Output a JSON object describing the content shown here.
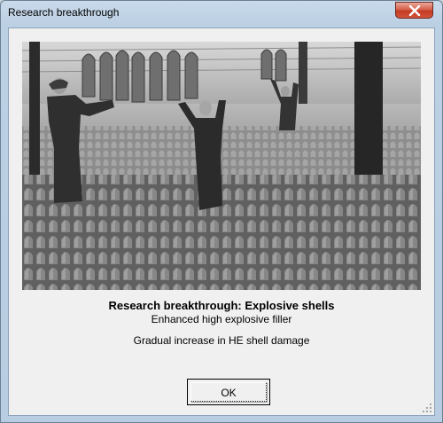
{
  "window": {
    "title": "Research breakthrough",
    "close_icon": "close-icon"
  },
  "colors": {
    "close_button": "#c43a25",
    "dialog_background": "#f0f0f0",
    "frame": "#bcd0e4"
  },
  "image": {
    "subject": "photo-munitions-factory"
  },
  "research": {
    "heading": "Research breakthrough: Explosive shells",
    "name": "Enhanced high explosive filler",
    "effect": "Gradual increase in HE shell damage"
  },
  "buttons": {
    "ok_label": "OK"
  }
}
